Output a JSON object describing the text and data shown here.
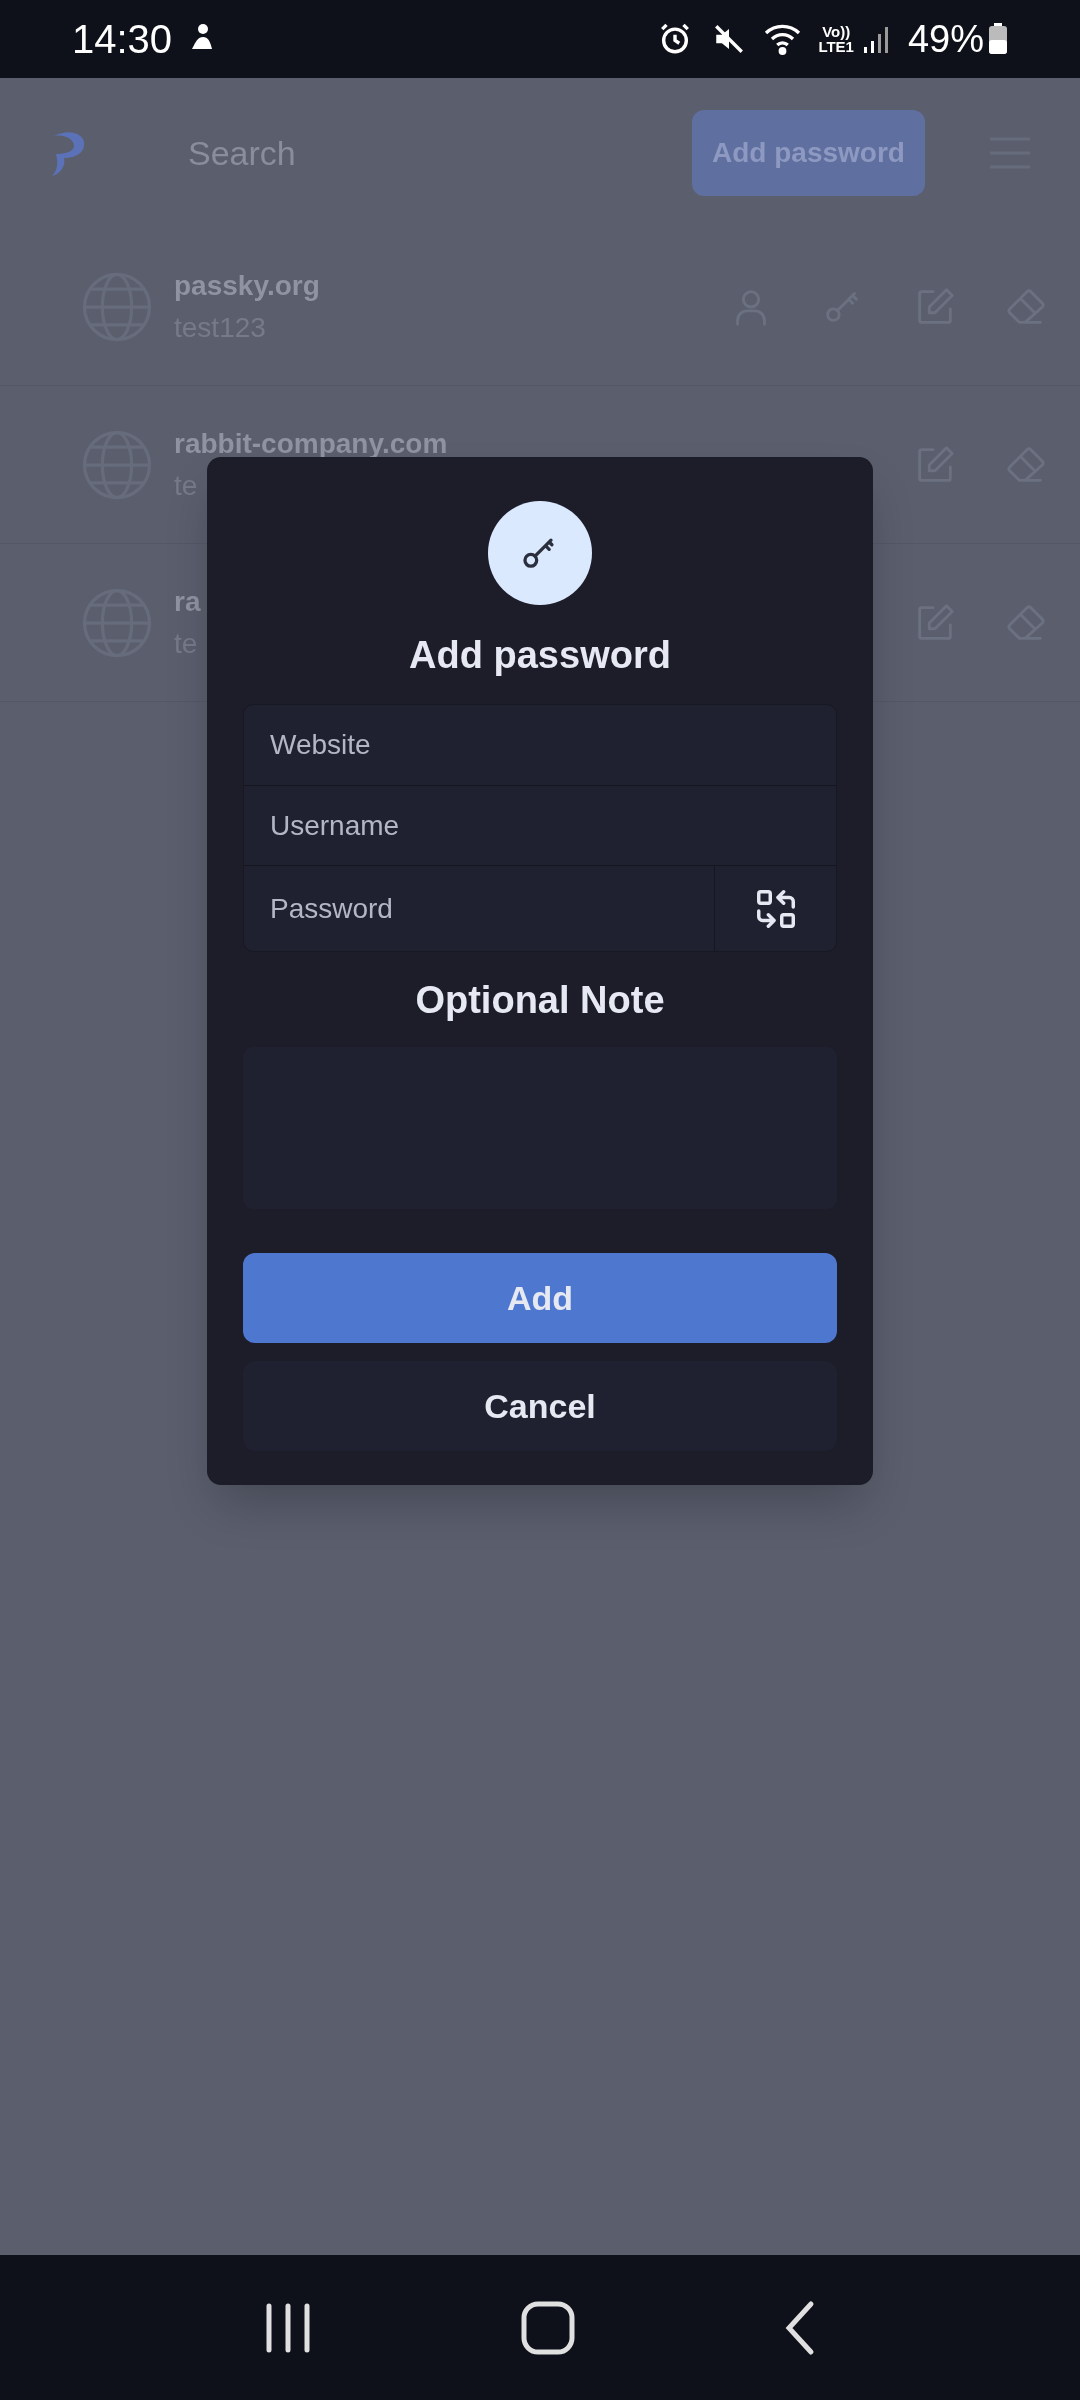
{
  "status_bar": {
    "time": "14:30",
    "network": [
      "Vo))",
      "LTE1"
    ],
    "battery": "49%"
  },
  "header": {
    "search": {
      "placeholder": "Search"
    },
    "add_button": "Add password"
  },
  "passwords": [
    {
      "website": "passky.org",
      "username": "test123",
      "covered": false
    },
    {
      "website": "rabbit-company.com",
      "username": "te",
      "covered": true
    },
    {
      "website": "ra",
      "username": "te",
      "covered": true
    }
  ],
  "dialog": {
    "title": "Add password",
    "fields": [
      {
        "placeholder": "Website",
        "kind": "text"
      },
      {
        "placeholder": "Username",
        "kind": "text"
      },
      {
        "placeholder": "Password",
        "kind": "password"
      }
    ],
    "note_title": "Optional Note",
    "buttons": [
      {
        "label": "Add",
        "kind": "primary"
      },
      {
        "label": "Cancel",
        "kind": "secondary"
      }
    ]
  }
}
